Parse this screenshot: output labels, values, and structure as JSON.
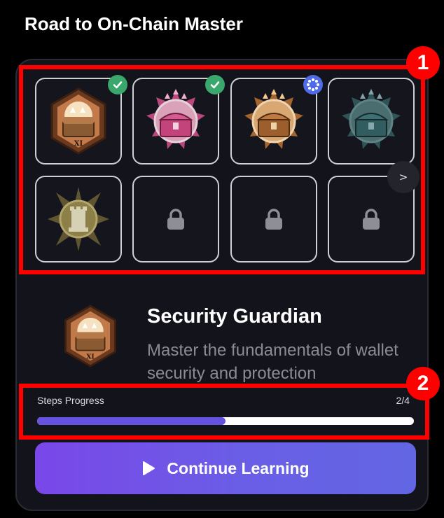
{
  "header": {
    "title": "Road to On-Chain Master"
  },
  "grid": {
    "tiles": [
      {
        "icon": "bronze-hex-chest-badge-icon",
        "status": "completed",
        "label_on_badge": "XI"
      },
      {
        "icon": "pink-chest-badge-icon",
        "status": "completed"
      },
      {
        "icon": "bronze-chest-badge-icon",
        "status": "in-progress"
      },
      {
        "icon": "teal-chest-badge-icon",
        "status": "available"
      },
      {
        "icon": "olive-rook-badge-icon",
        "status": "available"
      },
      {
        "icon": "lock-icon",
        "status": "locked"
      },
      {
        "icon": "lock-icon",
        "status": "locked"
      },
      {
        "icon": "lock-icon",
        "status": "locked"
      }
    ],
    "next_label": ">"
  },
  "markers": {
    "m1": "1",
    "m2": "2"
  },
  "detail": {
    "title": "Security Guardian",
    "description": "Master the fundamentals of wallet security and protection",
    "icon_text": "XI"
  },
  "progress": {
    "label": "Steps Progress",
    "count": "2/4",
    "fraction": 0.5
  },
  "cta": {
    "label": "Continue Learning"
  },
  "colors": {
    "accent": "#6552e0",
    "check": "#3aa76d",
    "progress_badge": "#4f6be8",
    "annotation": "#ff0000"
  }
}
